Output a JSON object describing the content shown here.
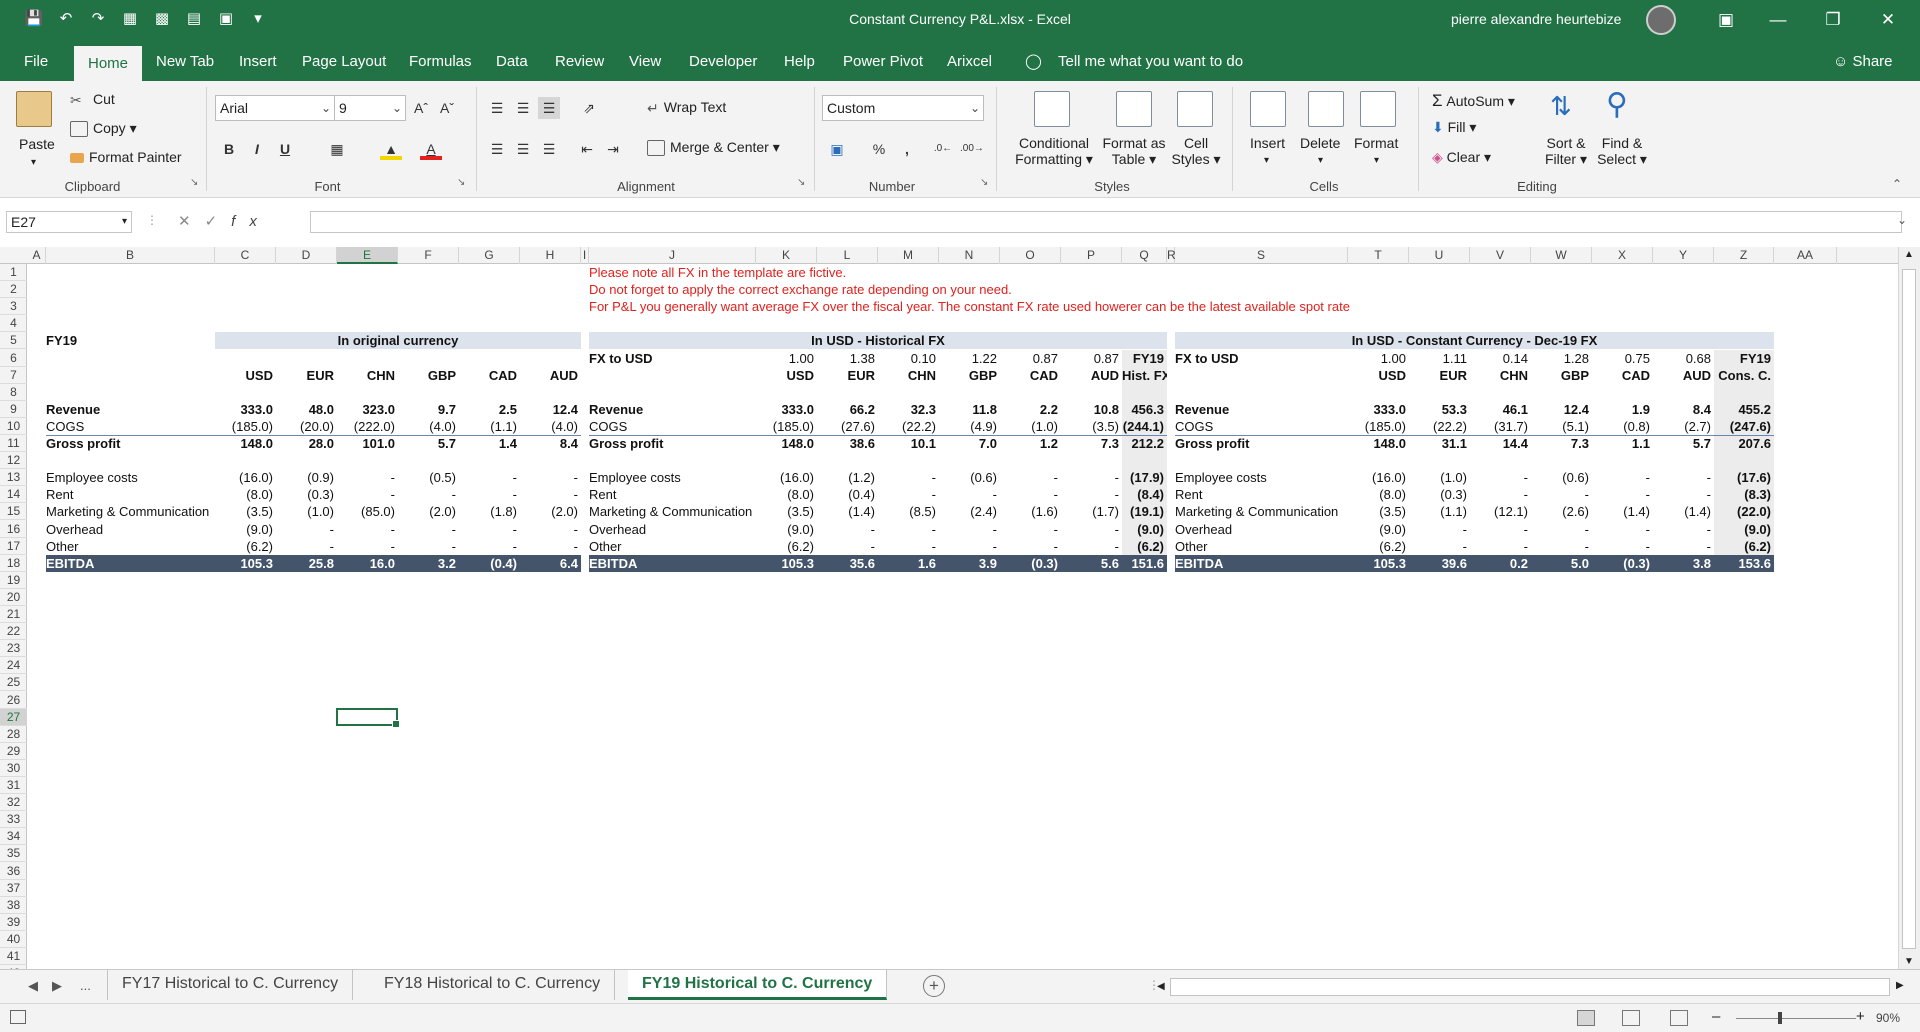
{
  "window": {
    "title": "Constant Currency P&L.xlsx  -  Excel",
    "user": "pierre alexandre heurtebize"
  },
  "tabs": [
    {
      "label": "File",
      "x": 0
    },
    {
      "label": "Home",
      "active": true
    },
    {
      "label": "New Tab"
    },
    {
      "label": "Insert"
    },
    {
      "label": "Page Layout"
    },
    {
      "label": "Formulas"
    },
    {
      "label": "Data"
    },
    {
      "label": "Review"
    },
    {
      "label": "View"
    },
    {
      "label": "Developer"
    },
    {
      "label": "Help"
    },
    {
      "label": "Power Pivot"
    },
    {
      "label": "Arixcel"
    }
  ],
  "tellme": "Tell me what you want to do",
  "share": "Share",
  "ribbon": {
    "clipboard": {
      "paste": "Paste",
      "cut": "Cut",
      "copy": "Copy",
      "format_painter": "Format Painter",
      "label": "Clipboard"
    },
    "font": {
      "family": "Arial",
      "size": "9",
      "bold": "B",
      "italic": "I",
      "underline": "U",
      "label": "Font"
    },
    "alignment": {
      "wrap": "Wrap Text",
      "merge": "Merge & Center",
      "label": "Alignment"
    },
    "number": {
      "format": "Custom",
      "percent": "%",
      "comma": ",",
      "label": "Number"
    },
    "styles": {
      "conditional": "Conditional",
      "formatting": "Formatting",
      "format_as": "Format as",
      "table": "Table",
      "cell": "Cell",
      "styles_btn": "Styles",
      "label": "Styles"
    },
    "cells": {
      "insert": "Insert",
      "delete": "Delete",
      "format": "Format",
      "label": "Cells"
    },
    "editing": {
      "autosum": "AutoSum",
      "fill": "Fill",
      "clear": "Clear",
      "sort": "Sort &",
      "filter": "Filter",
      "find": "Find &",
      "select": "Select",
      "label": "Editing"
    }
  },
  "formula_bar": {
    "name_box": "E27",
    "fx": "fx",
    "value": ""
  },
  "columns": [
    "A",
    "B",
    "C",
    "D",
    "E",
    "F",
    "G",
    "H",
    "I",
    "J",
    "K",
    "L",
    "M",
    "N",
    "O",
    "P",
    "Q",
    "R",
    "S",
    "T",
    "U",
    "V",
    "W",
    "X",
    "Y",
    "Z",
    "AA"
  ],
  "rows": [
    "1",
    "2",
    "3",
    "4",
    "5",
    "6",
    "7",
    "8",
    "9",
    "10",
    "11",
    "12",
    "13",
    "14",
    "15",
    "16",
    "17",
    "18",
    "19",
    "20",
    "21",
    "22",
    "23",
    "24",
    "25",
    "26",
    "27",
    "28",
    "29",
    "30",
    "31",
    "32",
    "33",
    "34",
    "35",
    "36",
    "37",
    "38",
    "39",
    "40",
    "41",
    "42",
    "43"
  ],
  "notes": [
    "Please note all FX in the template are fictive.",
    "Do not forget to apply the correct exchange rate depending on your need.",
    "For P&L you generally want average FX over the fiscal year. The constant FX rate used howerer can be the latest available spot rate"
  ],
  "sheet": {
    "fy": "FY19",
    "orig_title": "In original currency",
    "hist_title": "In USD - Historical FX",
    "const_title": "In USD - Constant Currency - Dec-19 FX",
    "fx_to_usd": "FX to USD",
    "hist_fx": [
      "1.00",
      "1.38",
      "0.10",
      "1.22",
      "0.87",
      "0.87"
    ],
    "const_fx": [
      "1.00",
      "1.11",
      "0.14",
      "1.28",
      "0.75",
      "0.68"
    ],
    "fy19": "FY19",
    "ccy": [
      "USD",
      "EUR",
      "CHN",
      "GBP",
      "CAD",
      "AUD"
    ],
    "hist_total_hdr": "Hist. FX",
    "const_total_hdr": "Cons. C.",
    "lines": [
      {
        "label": "Revenue",
        "bold": true,
        "orig": [
          "333.0",
          "48.0",
          "323.0",
          "9.7",
          "2.5",
          "12.4"
        ],
        "hist": [
          "333.0",
          "66.2",
          "32.3",
          "11.8",
          "2.2",
          "10.8",
          "456.3"
        ],
        "const": [
          "333.0",
          "53.3",
          "46.1",
          "12.4",
          "1.9",
          "8.4",
          "455.2"
        ]
      },
      {
        "label": "COGS",
        "bold": false,
        "orig": [
          "(185.0)",
          "(20.0)",
          "(222.0)",
          "(4.0)",
          "(1.1)",
          "(4.0)"
        ],
        "hist": [
          "(185.0)",
          "(27.6)",
          "(22.2)",
          "(4.9)",
          "(1.0)",
          "(3.5)",
          "(244.1)"
        ],
        "const": [
          "(185.0)",
          "(22.2)",
          "(31.7)",
          "(5.1)",
          "(0.8)",
          "(2.7)",
          "(247.6)"
        ]
      },
      {
        "label": "Gross profit",
        "bold": true,
        "orig": [
          "148.0",
          "28.0",
          "101.0",
          "5.7",
          "1.4",
          "8.4"
        ],
        "hist": [
          "148.0",
          "38.6",
          "10.1",
          "7.0",
          "1.2",
          "7.3",
          "212.2"
        ],
        "const": [
          "148.0",
          "31.1",
          "14.4",
          "7.3",
          "1.1",
          "5.7",
          "207.6"
        ]
      },
      {
        "label": "Employee costs",
        "bold": false,
        "orig": [
          "(16.0)",
          "(0.9)",
          "-",
          "(0.5)",
          "-",
          "-"
        ],
        "hist": [
          "(16.0)",
          "(1.2)",
          "-",
          "(0.6)",
          "-",
          "-",
          "(17.9)"
        ],
        "const": [
          "(16.0)",
          "(1.0)",
          "-",
          "(0.6)",
          "-",
          "-",
          "(17.6)"
        ]
      },
      {
        "label": "Rent",
        "bold": false,
        "orig": [
          "(8.0)",
          "(0.3)",
          "-",
          "-",
          "-",
          "-"
        ],
        "hist": [
          "(8.0)",
          "(0.4)",
          "-",
          "-",
          "-",
          "-",
          "(8.4)"
        ],
        "const": [
          "(8.0)",
          "(0.3)",
          "-",
          "-",
          "-",
          "-",
          "(8.3)"
        ]
      },
      {
        "label": "Marketing & Communication",
        "bold": false,
        "orig": [
          "(3.5)",
          "(1.0)",
          "(85.0)",
          "(2.0)",
          "(1.8)",
          "(2.0)"
        ],
        "hist": [
          "(3.5)",
          "(1.4)",
          "(8.5)",
          "(2.4)",
          "(1.6)",
          "(1.7)",
          "(19.1)"
        ],
        "const": [
          "(3.5)",
          "(1.1)",
          "(12.1)",
          "(2.6)",
          "(1.4)",
          "(1.4)",
          "(22.0)"
        ]
      },
      {
        "label": "Overhead",
        "bold": false,
        "orig": [
          "(9.0)",
          "-",
          "-",
          "-",
          "-",
          "-"
        ],
        "hist": [
          "(9.0)",
          "-",
          "-",
          "-",
          "-",
          "-",
          "(9.0)"
        ],
        "const": [
          "(9.0)",
          "-",
          "-",
          "-",
          "-",
          "-",
          "(9.0)"
        ]
      },
      {
        "label": "Other",
        "bold": false,
        "orig": [
          "(6.2)",
          "-",
          "-",
          "-",
          "-",
          "-"
        ],
        "hist": [
          "(6.2)",
          "-",
          "-",
          "-",
          "-",
          "-",
          "(6.2)"
        ],
        "const": [
          "(6.2)",
          "-",
          "-",
          "-",
          "-",
          "-",
          "(6.2)"
        ]
      },
      {
        "label": "EBITDA",
        "bold": true,
        "orig": [
          "105.3",
          "25.8",
          "16.0",
          "3.2",
          "(0.4)",
          "6.4"
        ],
        "hist": [
          "105.3",
          "35.6",
          "1.6",
          "3.9",
          "(0.3)",
          "5.6",
          "151.6"
        ],
        "const": [
          "105.3",
          "39.6",
          "0.2",
          "5.0",
          "(0.3)",
          "3.8",
          "153.6"
        ]
      }
    ]
  },
  "sheet_tabs": [
    {
      "label": "FY17 Historical to C. Currency"
    },
    {
      "label": "FY18 Historical to C. Currency"
    },
    {
      "label": "FY19 Historical to C. Currency",
      "active": true
    }
  ],
  "status": {
    "zoom": "90%"
  },
  "colors": {
    "excel_green": "#217346",
    "header_band": "#dde3ec",
    "ebitda_band": "#44546a",
    "note_red": "#e0211d"
  }
}
